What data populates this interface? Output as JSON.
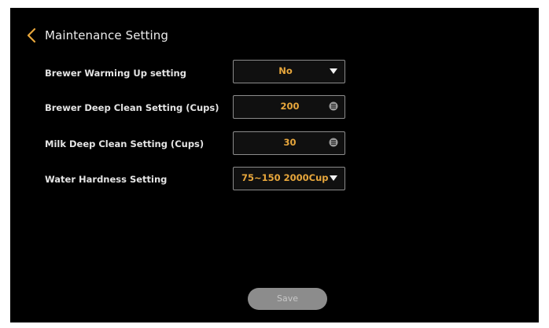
{
  "header": {
    "title": "Maintenance Setting"
  },
  "settings": [
    {
      "label": "Brewer Warming Up setting",
      "value": "No",
      "control": "dropdown"
    },
    {
      "label": "Brewer Deep Clean Setting (Cups)",
      "value": "200",
      "control": "number"
    },
    {
      "label": "Milk Deep Clean Setting (Cups)",
      "value": "30",
      "control": "number"
    },
    {
      "label": "Water Hardness Setting",
      "value": "75~150 2000Cup",
      "control": "dropdown"
    }
  ],
  "footer": {
    "save_label": "Save"
  },
  "colors": {
    "background": "#000000",
    "accent": "#e8a73c",
    "field_border": "#8c8c8c",
    "save_button": "#8c8c8c"
  }
}
